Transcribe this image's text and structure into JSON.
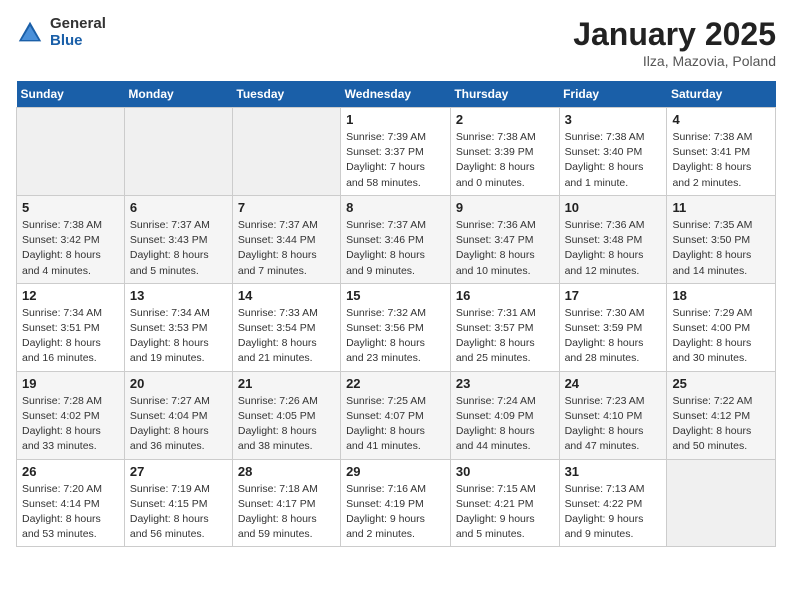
{
  "header": {
    "logo_general": "General",
    "logo_blue": "Blue",
    "title": "January 2025",
    "subtitle": "Ilza, Mazovia, Poland"
  },
  "weekdays": [
    "Sunday",
    "Monday",
    "Tuesday",
    "Wednesday",
    "Thursday",
    "Friday",
    "Saturday"
  ],
  "weeks": [
    [
      {
        "day": "",
        "info": ""
      },
      {
        "day": "",
        "info": ""
      },
      {
        "day": "",
        "info": ""
      },
      {
        "day": "1",
        "info": "Sunrise: 7:39 AM\nSunset: 3:37 PM\nDaylight: 7 hours\nand 58 minutes."
      },
      {
        "day": "2",
        "info": "Sunrise: 7:38 AM\nSunset: 3:39 PM\nDaylight: 8 hours\nand 0 minutes."
      },
      {
        "day": "3",
        "info": "Sunrise: 7:38 AM\nSunset: 3:40 PM\nDaylight: 8 hours\nand 1 minute."
      },
      {
        "day": "4",
        "info": "Sunrise: 7:38 AM\nSunset: 3:41 PM\nDaylight: 8 hours\nand 2 minutes."
      }
    ],
    [
      {
        "day": "5",
        "info": "Sunrise: 7:38 AM\nSunset: 3:42 PM\nDaylight: 8 hours\nand 4 minutes."
      },
      {
        "day": "6",
        "info": "Sunrise: 7:37 AM\nSunset: 3:43 PM\nDaylight: 8 hours\nand 5 minutes."
      },
      {
        "day": "7",
        "info": "Sunrise: 7:37 AM\nSunset: 3:44 PM\nDaylight: 8 hours\nand 7 minutes."
      },
      {
        "day": "8",
        "info": "Sunrise: 7:37 AM\nSunset: 3:46 PM\nDaylight: 8 hours\nand 9 minutes."
      },
      {
        "day": "9",
        "info": "Sunrise: 7:36 AM\nSunset: 3:47 PM\nDaylight: 8 hours\nand 10 minutes."
      },
      {
        "day": "10",
        "info": "Sunrise: 7:36 AM\nSunset: 3:48 PM\nDaylight: 8 hours\nand 12 minutes."
      },
      {
        "day": "11",
        "info": "Sunrise: 7:35 AM\nSunset: 3:50 PM\nDaylight: 8 hours\nand 14 minutes."
      }
    ],
    [
      {
        "day": "12",
        "info": "Sunrise: 7:34 AM\nSunset: 3:51 PM\nDaylight: 8 hours\nand 16 minutes."
      },
      {
        "day": "13",
        "info": "Sunrise: 7:34 AM\nSunset: 3:53 PM\nDaylight: 8 hours\nand 19 minutes."
      },
      {
        "day": "14",
        "info": "Sunrise: 7:33 AM\nSunset: 3:54 PM\nDaylight: 8 hours\nand 21 minutes."
      },
      {
        "day": "15",
        "info": "Sunrise: 7:32 AM\nSunset: 3:56 PM\nDaylight: 8 hours\nand 23 minutes."
      },
      {
        "day": "16",
        "info": "Sunrise: 7:31 AM\nSunset: 3:57 PM\nDaylight: 8 hours\nand 25 minutes."
      },
      {
        "day": "17",
        "info": "Sunrise: 7:30 AM\nSunset: 3:59 PM\nDaylight: 8 hours\nand 28 minutes."
      },
      {
        "day": "18",
        "info": "Sunrise: 7:29 AM\nSunset: 4:00 PM\nDaylight: 8 hours\nand 30 minutes."
      }
    ],
    [
      {
        "day": "19",
        "info": "Sunrise: 7:28 AM\nSunset: 4:02 PM\nDaylight: 8 hours\nand 33 minutes."
      },
      {
        "day": "20",
        "info": "Sunrise: 7:27 AM\nSunset: 4:04 PM\nDaylight: 8 hours\nand 36 minutes."
      },
      {
        "day": "21",
        "info": "Sunrise: 7:26 AM\nSunset: 4:05 PM\nDaylight: 8 hours\nand 38 minutes."
      },
      {
        "day": "22",
        "info": "Sunrise: 7:25 AM\nSunset: 4:07 PM\nDaylight: 8 hours\nand 41 minutes."
      },
      {
        "day": "23",
        "info": "Sunrise: 7:24 AM\nSunset: 4:09 PM\nDaylight: 8 hours\nand 44 minutes."
      },
      {
        "day": "24",
        "info": "Sunrise: 7:23 AM\nSunset: 4:10 PM\nDaylight: 8 hours\nand 47 minutes."
      },
      {
        "day": "25",
        "info": "Sunrise: 7:22 AM\nSunset: 4:12 PM\nDaylight: 8 hours\nand 50 minutes."
      }
    ],
    [
      {
        "day": "26",
        "info": "Sunrise: 7:20 AM\nSunset: 4:14 PM\nDaylight: 8 hours\nand 53 minutes."
      },
      {
        "day": "27",
        "info": "Sunrise: 7:19 AM\nSunset: 4:15 PM\nDaylight: 8 hours\nand 56 minutes."
      },
      {
        "day": "28",
        "info": "Sunrise: 7:18 AM\nSunset: 4:17 PM\nDaylight: 8 hours\nand 59 minutes."
      },
      {
        "day": "29",
        "info": "Sunrise: 7:16 AM\nSunset: 4:19 PM\nDaylight: 9 hours\nand 2 minutes."
      },
      {
        "day": "30",
        "info": "Sunrise: 7:15 AM\nSunset: 4:21 PM\nDaylight: 9 hours\nand 5 minutes."
      },
      {
        "day": "31",
        "info": "Sunrise: 7:13 AM\nSunset: 4:22 PM\nDaylight: 9 hours\nand 9 minutes."
      },
      {
        "day": "",
        "info": ""
      }
    ]
  ]
}
